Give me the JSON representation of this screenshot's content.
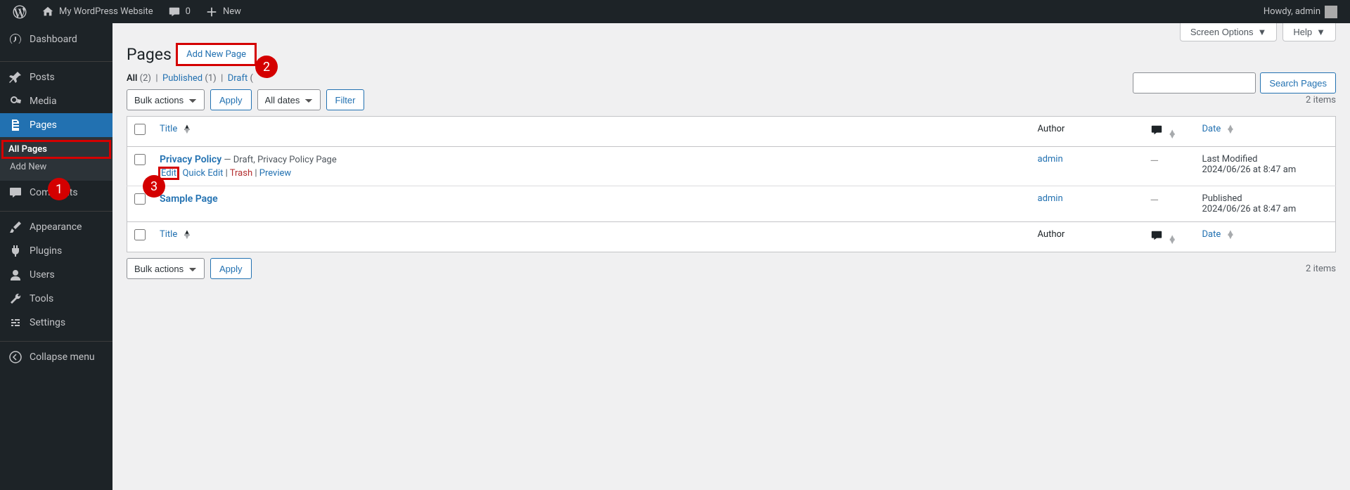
{
  "adminbar": {
    "site_name": "My WordPress Website",
    "comments_count": "0",
    "new_label": "New",
    "howdy": "Howdy, admin"
  },
  "sidebar": {
    "dashboard": "Dashboard",
    "posts": "Posts",
    "media": "Media",
    "pages": "Pages",
    "pages_sub_all": "All Pages",
    "pages_sub_addnew": "Add New",
    "comments": "Comments",
    "appearance": "Appearance",
    "plugins": "Plugins",
    "users": "Users",
    "tools": "Tools",
    "settings": "Settings",
    "collapse": "Collapse menu"
  },
  "screen": {
    "options": "Screen Options",
    "help": "Help"
  },
  "page": {
    "title": "Pages",
    "add_new": "Add New Page",
    "filters": {
      "all_label": "All",
      "all_count": "(2)",
      "published_label": "Published",
      "published_count": "(1)",
      "draft_label": "Draft",
      "draft_count": "("
    },
    "bulk_label": "Bulk actions",
    "apply": "Apply",
    "dates_label": "All dates",
    "filter": "Filter",
    "count": "2 items",
    "search_btn": "Search Pages"
  },
  "table": {
    "cols": {
      "title": "Title",
      "author": "Author",
      "date": "Date"
    },
    "rows": [
      {
        "title": "Privacy Policy",
        "title_suffix": " — Draft, Privacy Policy Page",
        "author": "admin",
        "comments": "—",
        "date_line1": "Last Modified",
        "date_line2": "2024/06/26 at 8:47 am",
        "actions": {
          "edit": "Edit",
          "quick": "Quick Edit",
          "trash": "Trash",
          "preview": "Preview"
        }
      },
      {
        "title": "Sample Page",
        "title_suffix": "",
        "author": "admin",
        "comments": "—",
        "date_line1": "Published",
        "date_line2": "2024/06/26 at 8:47 am"
      }
    ]
  },
  "annotations": {
    "n1": "1",
    "n2": "2",
    "n3": "3"
  }
}
